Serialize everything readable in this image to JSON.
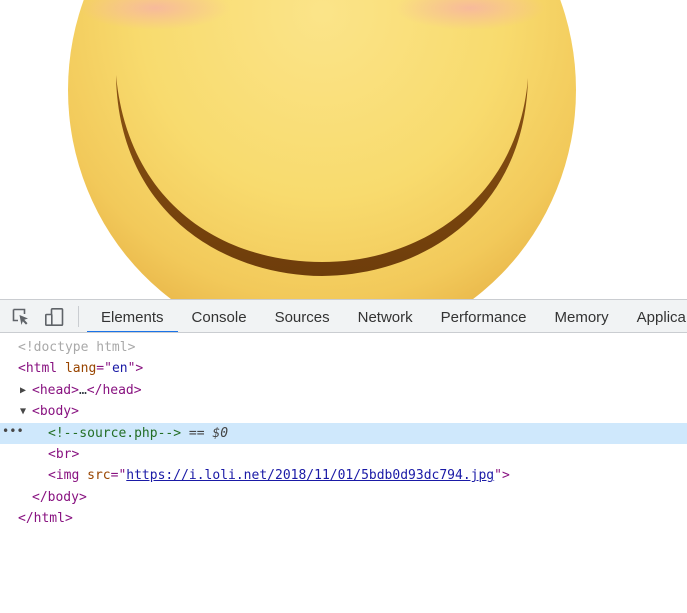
{
  "devtools": {
    "tabs": [
      {
        "label": "Elements",
        "active": true
      },
      {
        "label": "Console",
        "active": false
      },
      {
        "label": "Sources",
        "active": false
      },
      {
        "label": "Network",
        "active": false
      },
      {
        "label": "Performance",
        "active": false
      },
      {
        "label": "Memory",
        "active": false
      },
      {
        "label": "Applica",
        "active": false
      }
    ],
    "icons": [
      "inspect-element-icon",
      "device-toolbar-icon"
    ],
    "accent_color": "#1a73e8",
    "selected_row_color": "#cfe8fc"
  },
  "dom": {
    "doctype": "<!doctype html>",
    "html_open": {
      "tag": "html",
      "attr": "lang",
      "value": "en"
    },
    "head": {
      "open": "head",
      "ellipsis": "…",
      "close": "head",
      "expanded": false
    },
    "body": {
      "open": "body",
      "expanded": true
    },
    "comment": {
      "text": "<!--source.php-->",
      "suffix": "== $0"
    },
    "br": "br",
    "img": {
      "tag": "img",
      "attr": "src",
      "value": "https://i.loli.net/2018/11/01/5bdb0d93dc794.jpg"
    },
    "body_close": "body",
    "html_close": "html"
  }
}
